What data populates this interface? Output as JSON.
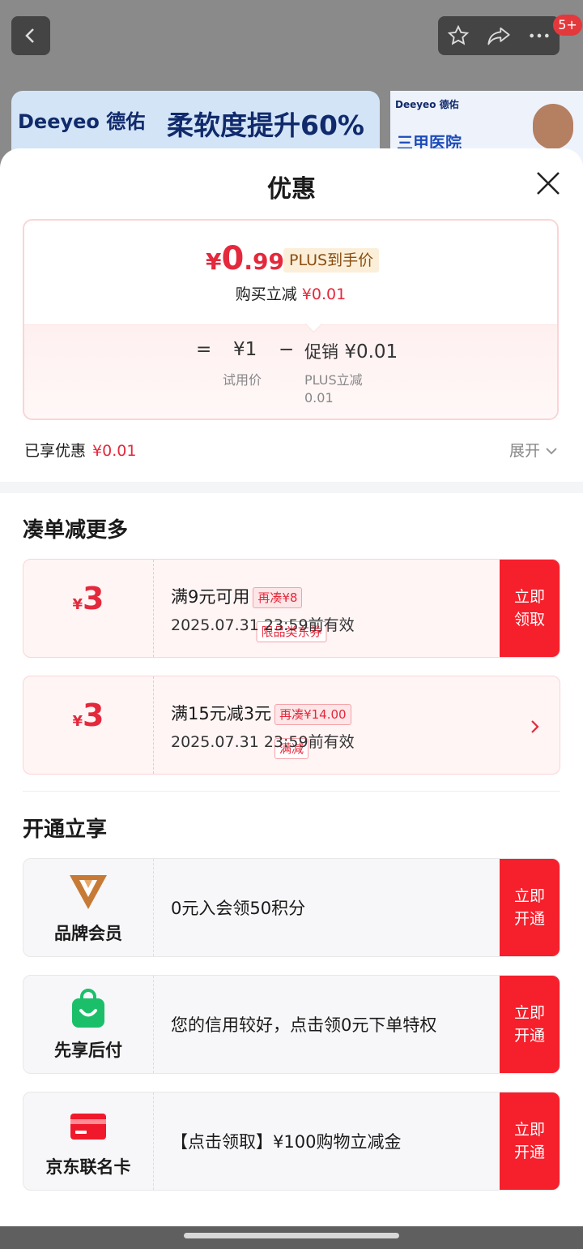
{
  "background": {
    "badge": "5+",
    "banner_brand": "Deeyeo 德佑",
    "banner_slogan": "柔软度提升60%",
    "banner_brand_small": "Deeyeo 德佑",
    "banner_hospital": "三甲医院"
  },
  "sheet": {
    "title": "优惠",
    "price": {
      "yen": "¥",
      "integer": "0",
      "decimal": ".99"
    },
    "plus_tag": "PLUS到手价",
    "discount_label": "购买立减",
    "discount_value": "¥0.01",
    "equation": {
      "eq": "=",
      "trial_value": "¥1",
      "trial_label": "试用价",
      "minus": "−",
      "promo_label": "促销",
      "promo_value": "¥0.01",
      "promo_sub1": "PLUS立减",
      "promo_sub2": "0.01"
    },
    "enjoyed_label": "已享优惠",
    "enjoyed_value": "¥0.01",
    "expand_label": "展开"
  },
  "more_section": {
    "title": "凑单减更多",
    "coupons": [
      {
        "yen": "¥",
        "amount": "3",
        "tag": "限品类东券",
        "desc": "满9元可用",
        "mini": "再凑¥8",
        "date": "2025.07.31 23:59前有效",
        "button": "立即\n领取"
      },
      {
        "yen": "¥",
        "amount": "3",
        "tag": "满减",
        "desc": "满15元减3元",
        "mini": "再凑¥14.00",
        "date": "2025.07.31 23:59前有效"
      }
    ]
  },
  "open_section": {
    "title": "开通立享",
    "perks": [
      {
        "icon": "brand-member-icon",
        "label": "品牌会员",
        "desc": "0元入会领50积分",
        "button": "立即\n开通"
      },
      {
        "icon": "shopping-bag-icon",
        "label": "先享后付",
        "desc": "您的信用较好，点击领0元下单特权",
        "button": "立即\n开通"
      },
      {
        "icon": "credit-card-icon",
        "label": "京东联名卡",
        "desc": "【点击领取】¥100购物立减金",
        "button": "立即\n开通"
      }
    ]
  },
  "colors": {
    "accent": "#e4293c",
    "button": "#f5202c",
    "plus_tag_bg": "#fcefd9"
  }
}
